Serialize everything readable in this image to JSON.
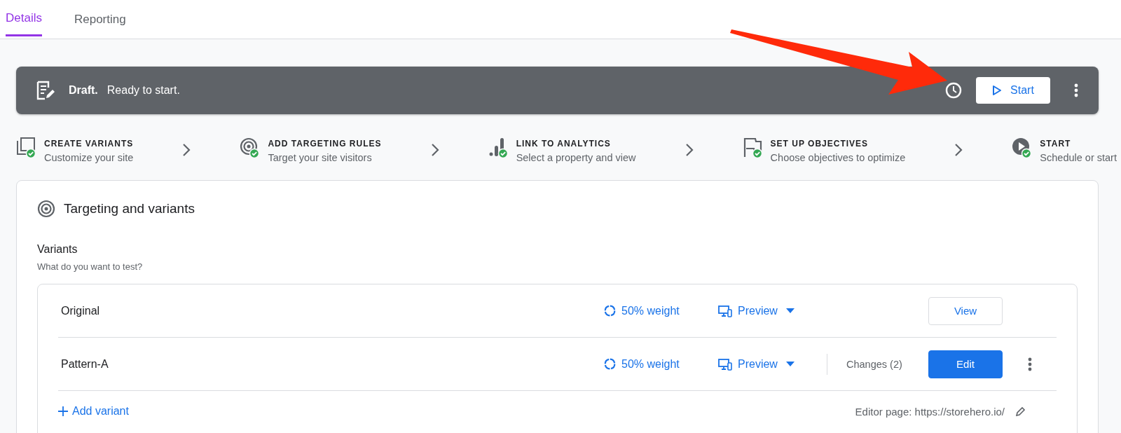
{
  "tabs": [
    {
      "label": "Details",
      "selected": true
    },
    {
      "label": "Reporting",
      "selected": false
    }
  ],
  "banner": {
    "status": "Draft.",
    "message": "Ready to start.",
    "button": "Start"
  },
  "steps": [
    {
      "kind": "variants",
      "title": "CREATE VARIANTS",
      "subtitle": "Customize your site",
      "done": true
    },
    {
      "kind": "targeting",
      "title": "ADD TARGETING RULES",
      "subtitle": "Target your site visitors",
      "done": true
    },
    {
      "kind": "analytics",
      "title": "LINK TO ANALYTICS",
      "subtitle": "Select a property and view",
      "done": true
    },
    {
      "kind": "objectives",
      "title": "SET UP OBJECTIVES",
      "subtitle": "Choose objectives to optimize",
      "done": true
    },
    {
      "kind": "start",
      "title": "START",
      "subtitle": "Schedule or start",
      "done": true
    }
  ],
  "card": {
    "title": "Targeting and variants",
    "variants_heading": "Variants",
    "variants_subtitle": "What do you want to test?",
    "variants": [
      {
        "kind": "original",
        "name": "Original",
        "weight": "50% weight",
        "preview": "Preview",
        "action": "View"
      },
      {
        "kind": "pattern",
        "name": "Pattern-A",
        "weight": "50% weight",
        "preview": "Preview",
        "changes": "Changes (2)",
        "action": "Edit"
      }
    ],
    "add_variant": "Add variant",
    "editor_page": "Editor page: https://storehero.io/"
  }
}
